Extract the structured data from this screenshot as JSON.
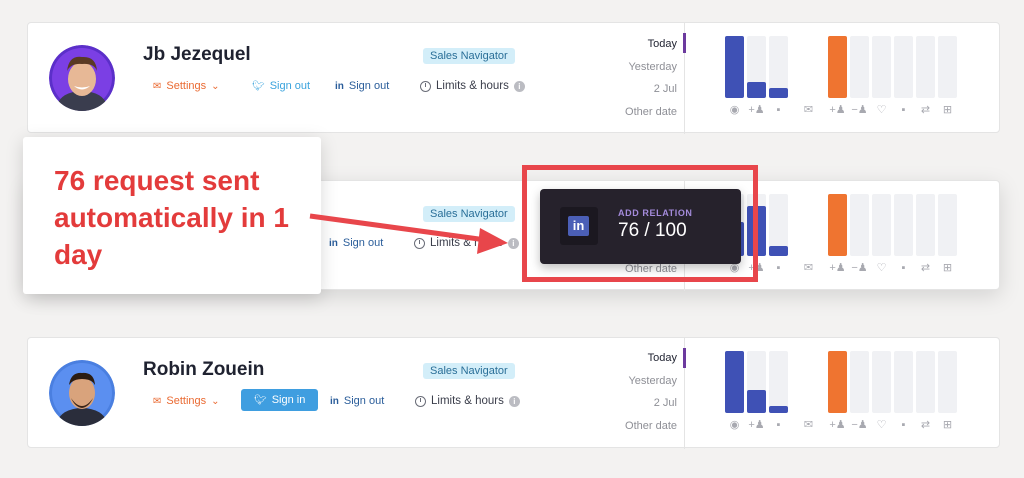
{
  "profiles": [
    {
      "name": "Jb Jezequel",
      "badge": "Sales Navigator",
      "settings_label": "Settings",
      "twitter_label": "Sign out",
      "linkedin_label": "Sign out",
      "limits_label": "Limits & hours",
      "dates": [
        "Today",
        "Yesterday",
        "2 Jul",
        "Other date"
      ],
      "bar_levels": [
        1.0,
        0.26,
        0.16,
        0,
        1.0,
        0,
        0,
        0,
        0,
        0
      ]
    },
    {
      "name": "",
      "badge": "Sales Navigator",
      "linkedin_label": "Sign out",
      "limits_label": "Limits & hours",
      "dates": [
        "Other date"
      ],
      "bar_levels": [
        0.55,
        0.8,
        0.16,
        0,
        1.0,
        0,
        0,
        0,
        0,
        0
      ]
    },
    {
      "name": "Robin Zouein",
      "badge": "Sales Navigator",
      "settings_label": "Settings",
      "twitter_label": "Sign in",
      "linkedin_label": "Sign out",
      "limits_label": "Limits & hours",
      "dates": [
        "Today",
        "Yesterday",
        "2 Jul",
        "Other date"
      ],
      "bar_levels": [
        1.0,
        0.37,
        0.11,
        0,
        1.0,
        0,
        0,
        0,
        0,
        0
      ]
    }
  ],
  "stat_icons": [
    "user-icon",
    "add-user-icon",
    "message-icon",
    "mail-icon",
    "add-user-icon",
    "remove-user-icon",
    "heart-icon",
    "comment-icon",
    "repost-icon",
    "add-post-icon"
  ],
  "callout": {
    "text": "76 request sent automatically in 1 day"
  },
  "tooltip": {
    "label": "ADD RELATION",
    "value": "76 / 100",
    "logo": "in"
  },
  "colors": {
    "blue_bar": "#3f51b5",
    "orange_bar": "#ef7430",
    "accent_red": "#e8464b",
    "badge_bg": "#d3eef9"
  }
}
